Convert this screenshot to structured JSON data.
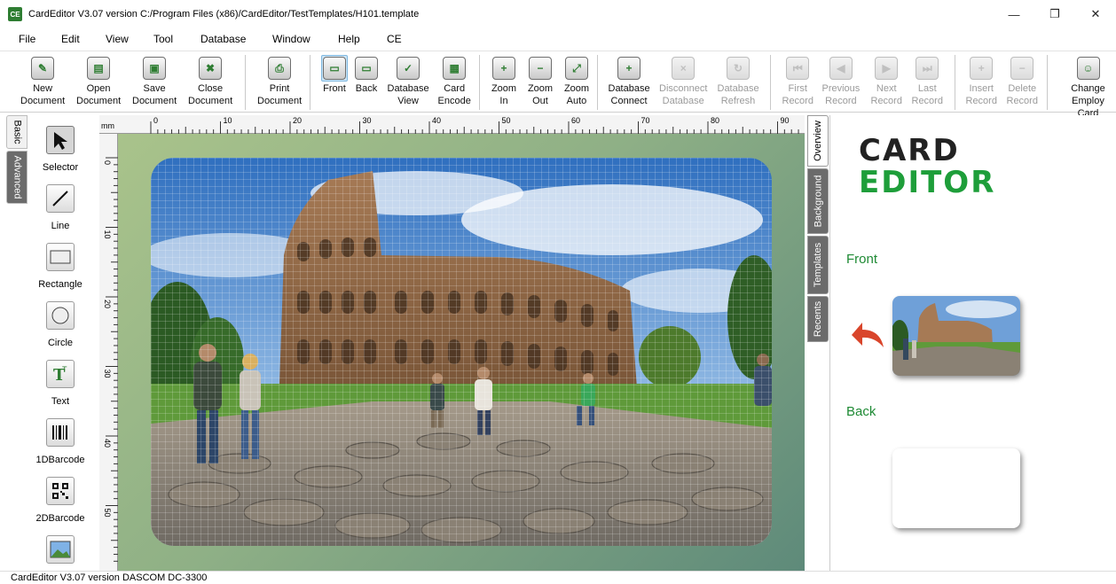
{
  "window": {
    "app_icon_text": "CE",
    "title": "CardEditor V3.07 version  C:/Program Files (x86)/CardEditor/TestTemplates/H101.template",
    "minimize": "—",
    "restore": "❐",
    "close": "✕"
  },
  "menu": [
    "File",
    "Edit",
    "View",
    "Tool",
    "Database",
    "Window",
    "Help",
    "CE"
  ],
  "toolbar": [
    {
      "label": "New\nDocument",
      "icon": "new-document-icon",
      "enabled": true
    },
    {
      "label": "Open\nDocument",
      "icon": "open-document-icon",
      "enabled": true
    },
    {
      "label": "Save\nDocument",
      "icon": "save-document-icon",
      "enabled": true
    },
    {
      "label": "Close\nDocument",
      "icon": "close-document-icon",
      "enabled": true
    },
    {
      "label": "Print\nDocument",
      "icon": "print-icon",
      "enabled": true
    },
    {
      "label": "Front",
      "icon": "front-side-icon",
      "enabled": true,
      "active": true
    },
    {
      "label": "Back",
      "icon": "back-side-icon",
      "enabled": true
    },
    {
      "label": "Database\nView",
      "icon": "database-view-icon",
      "enabled": true
    },
    {
      "label": "Card\nEncode",
      "icon": "card-encode-icon",
      "enabled": true
    },
    {
      "label": "Zoom\nIn",
      "icon": "zoom-in-icon",
      "enabled": true
    },
    {
      "label": "Zoom\nOut",
      "icon": "zoom-out-icon",
      "enabled": true
    },
    {
      "label": "Zoom\nAuto",
      "icon": "zoom-auto-icon",
      "enabled": true
    },
    {
      "label": "Database\nConnect",
      "icon": "database-connect-icon",
      "enabled": true
    },
    {
      "label": "Disconnect\nDatabase",
      "icon": "database-disconnect-icon",
      "enabled": false
    },
    {
      "label": "Database\nRefresh",
      "icon": "database-refresh-icon",
      "enabled": false
    },
    {
      "label": "First\nRecord",
      "icon": "first-record-icon",
      "enabled": false
    },
    {
      "label": "Previous\nRecord",
      "icon": "previous-record-icon",
      "enabled": false
    },
    {
      "label": "Next\nRecord",
      "icon": "next-record-icon",
      "enabled": false
    },
    {
      "label": "Last\nRecord",
      "icon": "last-record-icon",
      "enabled": false
    },
    {
      "label": "Insert\nRecord",
      "icon": "insert-record-icon",
      "enabled": false
    },
    {
      "label": "Delete\nRecord",
      "icon": "delete-record-icon",
      "enabled": false
    },
    {
      "label": "Change\nEmploy Card",
      "icon": "change-user-icon",
      "enabled": true
    }
  ],
  "left_tabs": {
    "basic": "Basic",
    "advanced": "Advanced"
  },
  "tools": [
    {
      "label": "Selector",
      "icon": "selector-arrow-icon"
    },
    {
      "label": "Line",
      "icon": "line-icon"
    },
    {
      "label": "Rectangle",
      "icon": "rectangle-icon"
    },
    {
      "label": "Circle",
      "icon": "circle-icon"
    },
    {
      "label": "Text",
      "icon": "text-icon"
    },
    {
      "label": "1DBarcode",
      "icon": "barcode-icon"
    },
    {
      "label": "2DBarcode",
      "icon": "qr-code-icon"
    },
    {
      "label": "Image",
      "icon": "image-icon"
    }
  ],
  "ruler": {
    "unit": "mm",
    "top_labels": [
      "0",
      "10",
      "20",
      "30",
      "40",
      "50",
      "60",
      "70",
      "80",
      "90"
    ],
    "left_labels": [
      "0",
      "10",
      "20",
      "30",
      "40",
      "50"
    ]
  },
  "right_tabs": {
    "overview": "Overview",
    "background": "Background",
    "templates": "Templates",
    "recents": "Recents"
  },
  "overview": {
    "logo_line1": "CARD",
    "logo_line2": "EDITOR",
    "front_label": "Front",
    "back_label": "Back"
  },
  "status": "CardEditor V3.07 version DASCOM DC-3300",
  "colors": {
    "brand_green": "#1e9e3a",
    "arrow_red": "#d9452b",
    "active_tab_blue": "#cde6f7"
  }
}
